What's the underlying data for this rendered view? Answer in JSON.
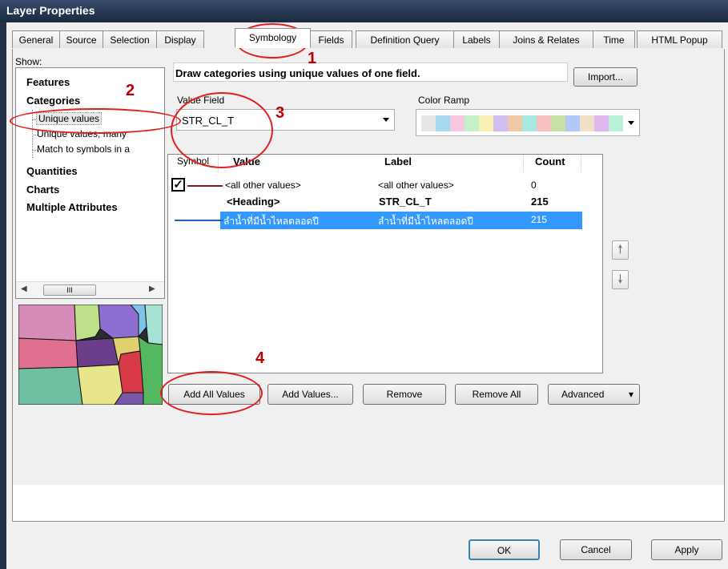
{
  "window": {
    "title": "Layer Properties"
  },
  "tabs": [
    {
      "label": "General"
    },
    {
      "label": "Source"
    },
    {
      "label": "Selection"
    },
    {
      "label": "Display"
    },
    {
      "label": "Symbology"
    },
    {
      "label": "Fields"
    },
    {
      "label": "Definition Query"
    },
    {
      "label": "Labels"
    },
    {
      "label": "Joins & Relates"
    },
    {
      "label": "Time"
    },
    {
      "label": "HTML Popup"
    }
  ],
  "show": {
    "label": "Show:",
    "items": [
      {
        "label": "Features"
      },
      {
        "label": "Categories"
      },
      {
        "label": "Unique values"
      },
      {
        "label": "Unique values, many"
      },
      {
        "label": "Match to symbols in a"
      },
      {
        "label": "Quantities"
      },
      {
        "label": "Charts"
      },
      {
        "label": "Multiple Attributes"
      }
    ],
    "scroll_thumb": "III"
  },
  "main": {
    "description": "Draw categories using unique values of one field.",
    "import_button": "Import...",
    "value_field_label": "Value Field",
    "value_field_value": "STR_CL_T",
    "color_ramp_label": "Color Ramp",
    "color_ramp_colors": [
      "#e6e6e6",
      "#a8d8f0",
      "#f7c8e0",
      "#c6f0c6",
      "#f9f0b4",
      "#d0c0f0",
      "#f0c8a8",
      "#a8e8e0",
      "#f8c0c0",
      "#c8e0a8",
      "#b4c8f8",
      "#f0e0c8",
      "#e0b8f0",
      "#b8f0d8"
    ]
  },
  "table": {
    "headers": {
      "symbol": "Symbol",
      "value": "Value",
      "label": "Label",
      "count": "Count"
    },
    "rows": [
      {
        "value": "<all other values>",
        "label": "<all other values>",
        "count": "0"
      },
      {
        "value": "<Heading>",
        "label": "STR_CL_T",
        "count": "215"
      },
      {
        "value": "ลำน้ำที่มีน้ำไหลตลอดปี",
        "label": "ลำน้ำที่มีน้ำไหลตลอดปี",
        "count": "215"
      }
    ],
    "checkbox_checked": true,
    "row_symbol_colors": [
      "#8b1a1a",
      "#1f5fbf"
    ]
  },
  "buttons": {
    "add_all": "Add All Values",
    "add": "Add Values...",
    "remove": "Remove",
    "remove_all": "Remove All",
    "advanced": "Advanced",
    "ok": "OK",
    "cancel": "Cancel",
    "apply": "Apply"
  },
  "annotations": {
    "n1": "1",
    "n2": "2",
    "n3": "3",
    "n4": "4"
  }
}
